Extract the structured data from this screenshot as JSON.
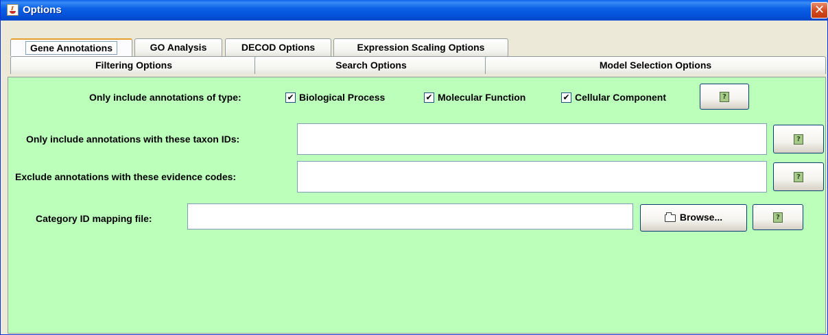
{
  "window": {
    "title": "Options",
    "close_glyph": "✕"
  },
  "tabs_row1": [
    {
      "label": "Gene Annotations",
      "selected": true
    },
    {
      "label": "GO Analysis",
      "selected": false
    },
    {
      "label": "DECOD Options",
      "selected": false
    },
    {
      "label": "Expression Scaling Options",
      "selected": false
    }
  ],
  "tabs_row2": [
    {
      "label": "Filtering Options"
    },
    {
      "label": "Search Options"
    },
    {
      "label": "Model Selection Options"
    }
  ],
  "annotation_types": {
    "label": "Only include annotations of type:",
    "options": [
      {
        "label": "Biological Process",
        "checked": true
      },
      {
        "label": "Molecular Function",
        "checked": true
      },
      {
        "label": "Cellular Component",
        "checked": true
      }
    ]
  },
  "taxon": {
    "label": "Only include annotations with these taxon IDs:",
    "value": ""
  },
  "evidence": {
    "label": "Exclude annotations with these evidence codes:",
    "value": ""
  },
  "mapping": {
    "label": "Category ID mapping file:",
    "value": "",
    "browse_label": "Browse..."
  },
  "glyphs": {
    "check": "✔",
    "help": "?"
  },
  "colors": {
    "panel_bg": "#bbffbb",
    "titlebar": "#0554dc",
    "selected_tab_accent": "#e6a02a"
  }
}
